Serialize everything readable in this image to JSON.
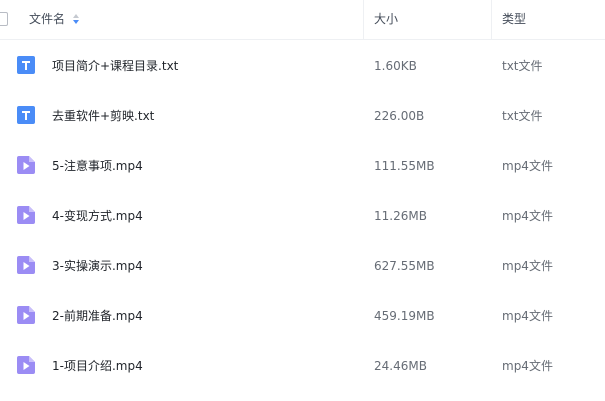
{
  "header": {
    "name_label": "文件名",
    "size_label": "大小",
    "type_label": "类型"
  },
  "files": [
    {
      "name": "项目简介+课程目录.txt",
      "size": "1.60KB",
      "type": "txt文件",
      "icon": "txt-file-icon"
    },
    {
      "name": "去重软件+剪映.txt",
      "size": "226.00B",
      "type": "txt文件",
      "icon": "txt-file-icon"
    },
    {
      "name": "5-注意事项.mp4",
      "size": "111.55MB",
      "type": "mp4文件",
      "icon": "video-file-icon"
    },
    {
      "name": "4-变现方式.mp4",
      "size": "11.26MB",
      "type": "mp4文件",
      "icon": "video-file-icon"
    },
    {
      "name": "3-实操演示.mp4",
      "size": "627.55MB",
      "type": "mp4文件",
      "icon": "video-file-icon"
    },
    {
      "name": "2-前期准备.mp4",
      "size": "459.19MB",
      "type": "mp4文件",
      "icon": "video-file-icon"
    },
    {
      "name": "1-项目介绍.mp4",
      "size": "24.46MB",
      "type": "mp4文件",
      "icon": "video-file-icon"
    }
  ],
  "colors": {
    "txt_icon": "#4a8cf7",
    "video_icon": "#9b8cf4",
    "sort_active": "#4a8cf7",
    "sort_inactive": "#c5c9d0"
  }
}
